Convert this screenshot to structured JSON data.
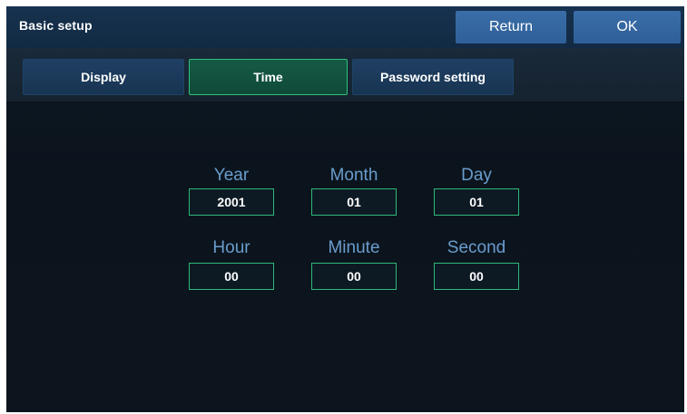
{
  "header": {
    "title": "Basic setup",
    "return_label": "Return",
    "ok_label": "OK"
  },
  "tabs": [
    {
      "label": "Display",
      "active": false
    },
    {
      "label": "Time",
      "active": true
    },
    {
      "label": "Password setting",
      "active": false
    }
  ],
  "time": {
    "year": {
      "label": "Year",
      "value": "2001"
    },
    "month": {
      "label": "Month",
      "value": "01"
    },
    "day": {
      "label": "Day",
      "value": "01"
    },
    "hour": {
      "label": "Hour",
      "value": "00"
    },
    "minute": {
      "label": "Minute",
      "value": "00"
    },
    "second": {
      "label": "Second",
      "value": "00"
    }
  },
  "colors": {
    "accent_green": "#2fb879",
    "button_blue": "#3a6ea8",
    "label_blue": "#6a9ccc",
    "background": "#0f1a24"
  }
}
